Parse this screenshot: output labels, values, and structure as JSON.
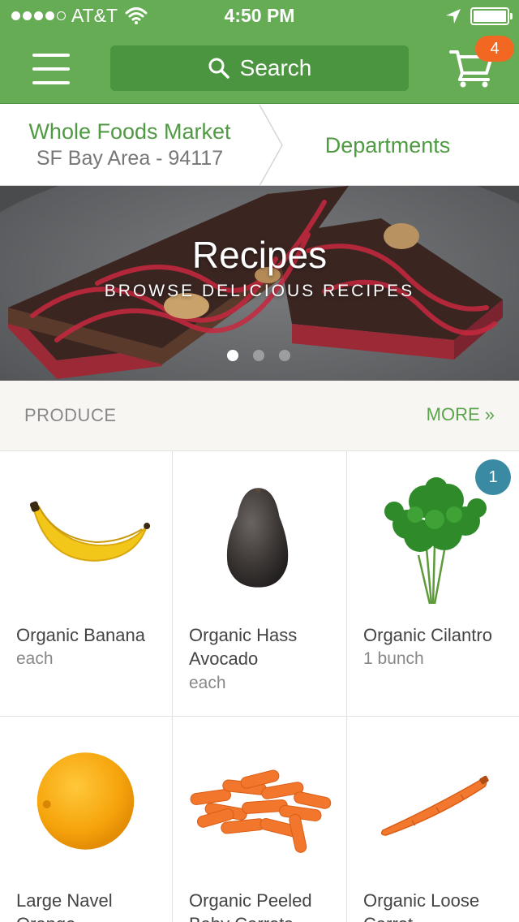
{
  "status_bar": {
    "carrier": "AT&T",
    "time": "4:50 PM"
  },
  "header": {
    "search_label": "Search",
    "cart_count": "4"
  },
  "store": {
    "name": "Whole Foods Market",
    "area": "SF Bay Area - 94117",
    "departments_label": "Departments"
  },
  "hero": {
    "title": "Recipes",
    "subtitle": "BROWSE DELICIOUS RECIPES",
    "slide_count": 3,
    "active_slide": 1
  },
  "section": {
    "title": "PRODUCE",
    "more_label": "MORE »"
  },
  "products": [
    {
      "name": "Organic Banana",
      "unit": "each",
      "image": "banana"
    },
    {
      "name": "Organic Hass Avocado",
      "unit": "each",
      "image": "avocado"
    },
    {
      "name": "Organic Cilantro",
      "unit": "1 bunch",
      "image": "cilantro",
      "quantity_in_cart": "1"
    },
    {
      "name": "Large Navel Orange",
      "unit": "",
      "image": "orange"
    },
    {
      "name": "Organic Peeled Baby Carrots",
      "unit": "",
      "image": "baby-carrots"
    },
    {
      "name": "Organic Loose Carrot",
      "unit": "",
      "image": "carrot"
    }
  ],
  "colors": {
    "brand_green": "#65ac55",
    "dark_green": "#4c9540",
    "badge_orange": "#f26722",
    "qty_blue": "#3a8aa3"
  }
}
